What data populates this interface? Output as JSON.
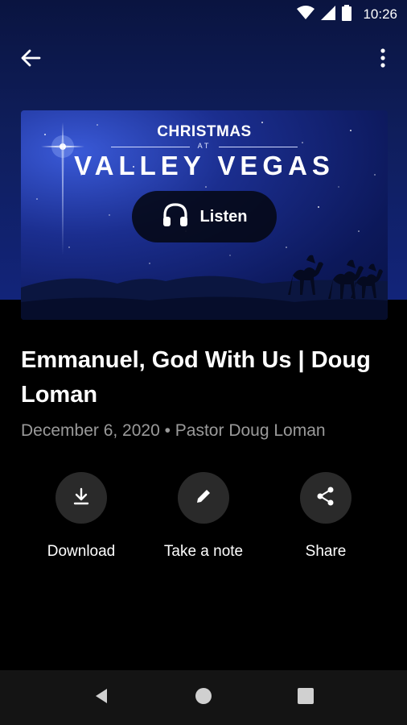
{
  "status_bar": {
    "time": "10:26"
  },
  "artwork": {
    "title_top": "CHRISTMAS",
    "title_mid": "AT",
    "title_main": "VALLEY VEGAS",
    "listen_label": "Listen"
  },
  "sermon": {
    "title": "Emmanuel, God With Us | Doug Loman",
    "meta": "December 6, 2020 • Pastor Doug Loman"
  },
  "actions": {
    "download": "Download",
    "note": "Take a note",
    "share": "Share"
  },
  "icons": [
    "wifi-icon",
    "signal-icon",
    "battery-icon",
    "back-arrow-icon",
    "more-vert-icon",
    "headphones-icon",
    "download-icon",
    "pencil-icon",
    "share-icon",
    "nav-back-icon",
    "nav-home-icon",
    "nav-recents-icon"
  ],
  "colors": {
    "hero": "#0f1e5c",
    "background": "#000000",
    "meta_text": "#9a9a9a",
    "action_circle": "#2a2a2a"
  }
}
